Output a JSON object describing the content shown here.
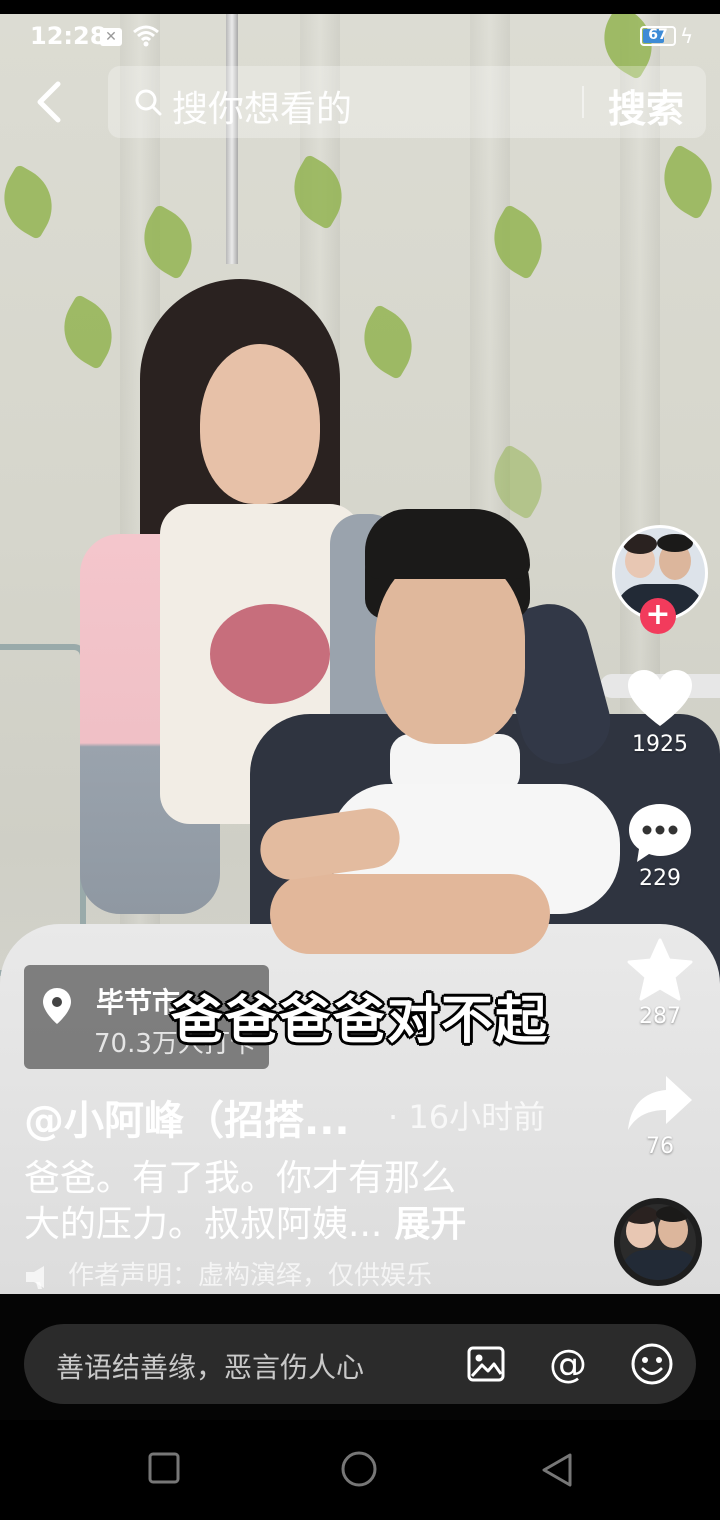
{
  "status_bar": {
    "time": "12:28",
    "battery": "67"
  },
  "search": {
    "placeholder": "搜你想看的",
    "button": "搜索"
  },
  "video": {
    "subtitle": "爸爸爸爸对不起"
  },
  "rail": {
    "likes": "1925",
    "comments": "229",
    "favorites": "287",
    "shares": "76"
  },
  "location": {
    "city": "毕节市",
    "count": "70.3万人打卡"
  },
  "post": {
    "author": "@小阿峰（招搭...",
    "time_ago": "· 16小时前",
    "caption_line1": "爸爸。有了我。你才有那么",
    "caption_line2": "大的压力。叔叔阿姨...",
    "expand": "展开",
    "disclaimer": "作者声明：虚构演绎，仅供娱乐"
  },
  "comment_bar": {
    "placeholder": "善语结善缘，恶言伤人心"
  },
  "colors": {
    "follow_plus": "#f23b5c",
    "battery_fill": "#3d8bd6"
  },
  "icons": [
    "back-icon",
    "search-icon",
    "heart-icon",
    "comment-icon",
    "star-icon",
    "share-icon",
    "location-pin-icon",
    "speaker-icon",
    "image-icon",
    "at-icon",
    "emoji-icon",
    "nav-square-icon",
    "nav-circle-icon",
    "nav-triangle-icon"
  ]
}
